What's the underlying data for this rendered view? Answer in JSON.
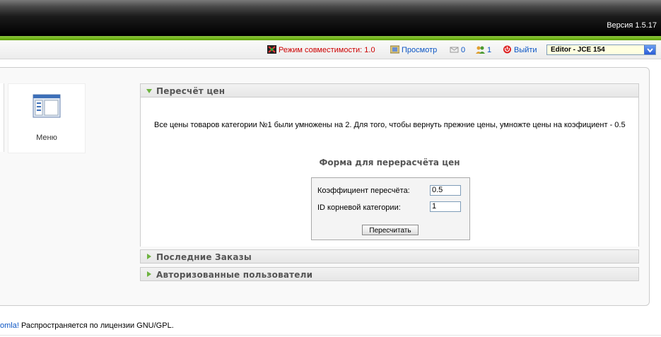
{
  "header": {
    "version": "Версия 1.5.17"
  },
  "statusbar": {
    "compat_mode": "Режим совместимости: 1.0",
    "preview": "Просмотр",
    "messages_count": "0",
    "users_count": "1",
    "logout": "Выйти",
    "editor_selected": "Editor - JCE 154"
  },
  "quickicons": {
    "menu_label": "Меню"
  },
  "panels": {
    "recalc": {
      "title": "Пересчёт цен",
      "message": "Все цены товаров категории №1 были умножены на 2. Для того, чтобы вернуть прежние цены, умножте цены на коэфициент - 0.5",
      "form_title": "Форма для перерасчёта цен",
      "coef_label": "Коэффициент пересчёта:",
      "coef_value": "0.5",
      "cat_label": "ID корневой категории:",
      "cat_value": "1",
      "button": "Пересчитать"
    },
    "orders": {
      "title": "Последние Заказы"
    },
    "users": {
      "title": "Авторизованные пользователи"
    }
  },
  "footer": {
    "link": "omla!",
    "text": " Распространяется по лицензии GNU/GPL."
  },
  "colors": {
    "accent_green": "#6db33f",
    "link_blue": "#0b55c4",
    "compat_red": "#cc0000"
  }
}
